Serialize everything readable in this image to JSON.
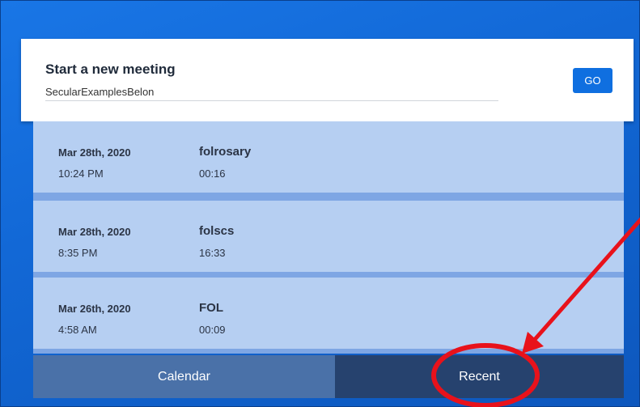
{
  "start_meeting": {
    "title": "Start a new meeting",
    "input_value": "SecularExamplesBelon",
    "go_label": "GO"
  },
  "meetings": [
    {
      "date": "Mar 28th, 2020",
      "time": "10:24 PM",
      "name": "folrosary",
      "duration": "00:16"
    },
    {
      "date": "Mar 28th, 2020",
      "time": "8:35 PM",
      "name": "folscs",
      "duration": "16:33"
    },
    {
      "date": "Mar 26th, 2020",
      "time": "4:58 AM",
      "name": "FOL",
      "duration": "00:09"
    }
  ],
  "tabs": {
    "calendar_label": "Calendar",
    "recent_label": "Recent"
  },
  "annotation_color": "#e8121b",
  "accent_color": "#0f6fe0"
}
